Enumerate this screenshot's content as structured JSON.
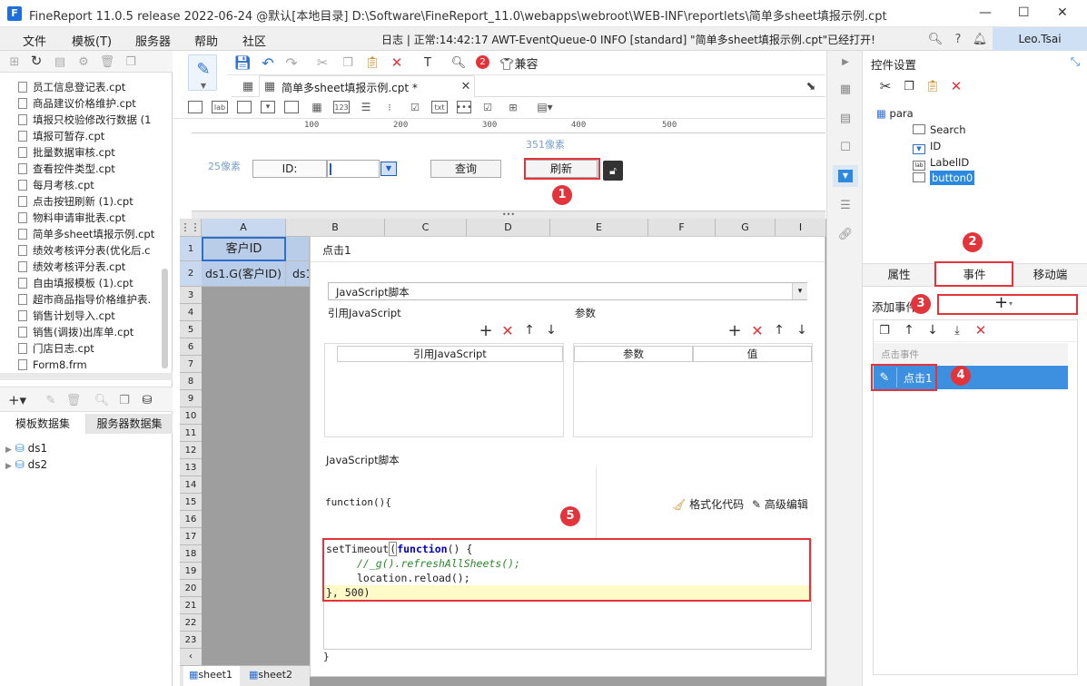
{
  "window": {
    "title": "FineReport 11.0.5 release 2022-06-24 @默认[本地目录]    D:\\Software\\FineReport_11.0\\webapps\\webroot\\WEB-INF\\reportlets\\简单多sheet填报示例.cpt",
    "logo_letter": "F"
  },
  "menu": {
    "items": [
      "文件",
      "模板(T)",
      "服务器",
      "帮助",
      "社区"
    ],
    "log": "日志 | 正常:14:42:17 AWT-EventQueue-0 INFO [standard] \"简单多sheet填报示例.cpt\"已经打开!",
    "user": "Leo.Tsai"
  },
  "files": [
    "员工信息登记表.cpt",
    "商品建议价格维护.cpt",
    "填报只校验修改行数据 (1",
    "填报可暂存.cpt",
    "批量数据审核.cpt",
    "查看控件类型.cpt",
    "每月考核.cpt",
    "点击按钮刷新 (1).cpt",
    "物料申请审批表.cpt",
    "简单多sheet填报示例.cpt",
    "绩效考核评分表(优化后.c",
    "绩效考核评分表.cpt",
    "自由填报模板 (1).cpt",
    "超市商品指导价格维护表.",
    "销售计划导入.cpt",
    "销售(调拨)出库单.cpt",
    "门店日志.cpt",
    "Form8.frm"
  ],
  "datasets": {
    "tab_template": "模板数据集",
    "tab_server": "服务器数据集",
    "items": [
      "ds1",
      "ds2"
    ]
  },
  "toolbar": {
    "badge": "2",
    "compat": "兼容"
  },
  "doc_tab": "简单多sheet填报示例.cpt *",
  "ruler": [
    "100",
    "200",
    "300",
    "400",
    "500"
  ],
  "param_pane": {
    "px351": "351像素",
    "px25": "25像素",
    "id_label": "ID:",
    "query_btn": "查询",
    "refresh_btn": "刷新"
  },
  "grid": {
    "cols": [
      "A",
      "B",
      "C",
      "D",
      "E",
      "F",
      "G",
      "I"
    ],
    "rows": [
      "1",
      "2",
      "3",
      "4",
      "5",
      "6",
      "7",
      "8",
      "9",
      "10",
      "11",
      "12",
      "13",
      "14",
      "15",
      "16",
      "17",
      "18",
      "19",
      "20",
      "21",
      "22",
      "23"
    ],
    "a1": "客户ID",
    "a2": "ds1.G(客户ID)",
    "b2": "ds1"
  },
  "dialog": {
    "title": "点击1",
    "type_select": "JavaScript脚本",
    "ref_js_label": "引用JavaScript",
    "params_label": "参数",
    "ref_js_header": "引用JavaScript",
    "param_header": "参数",
    "value_header": "值",
    "script_label": "JavaScript脚本",
    "func_open": "function(){",
    "format_code": "格式化代码",
    "advanced_edit": "高级编辑",
    "code1a": "setTimeout",
    "code1b": "(",
    "code1c": "function",
    "code1d": "() {",
    "code2": "//_g().refreshAllSheets();",
    "code3": "location.reload();",
    "code4": "}, 500)",
    "func_close": "}"
  },
  "right": {
    "title": "控件设置",
    "tree_root": "para",
    "tree": [
      "Search",
      "ID",
      "LabelID",
      "button0"
    ],
    "tabs": [
      "属性",
      "事件",
      "移动端"
    ],
    "add_event": "添加事件",
    "event_group": "点击事件",
    "event_item": "点击1"
  },
  "badges": [
    "1",
    "2",
    "3",
    "4",
    "5"
  ],
  "sheets": [
    "sheet1",
    "sheet2"
  ],
  "colors": {
    "accent": "#2b8ae0",
    "highlight": "#e2343a",
    "selected_row": "#3d8fe0",
    "code_yellow": "#fffbc8"
  }
}
